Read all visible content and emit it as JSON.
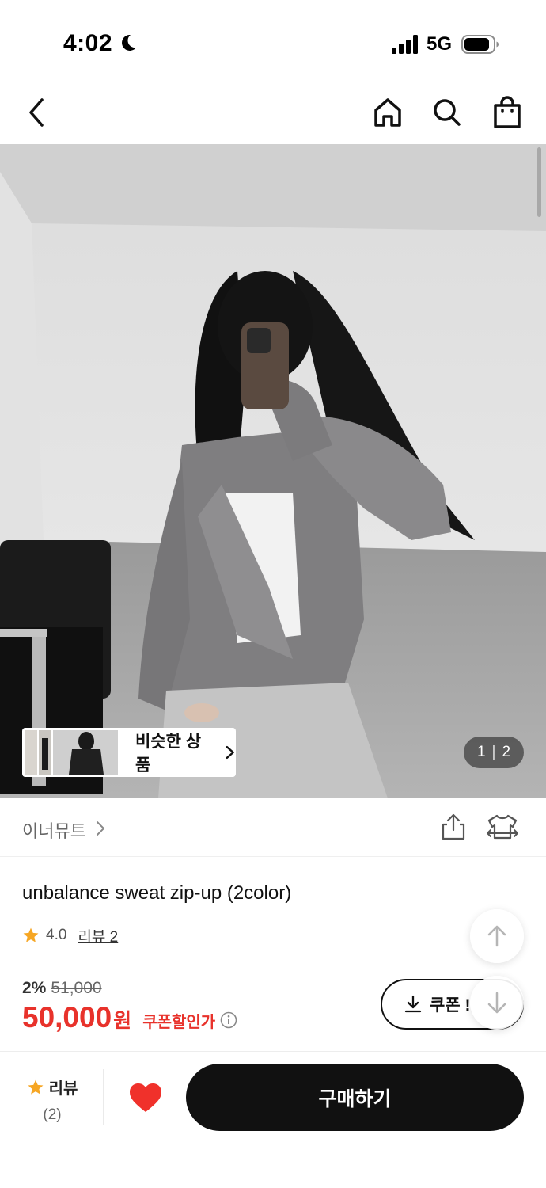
{
  "status_bar": {
    "time": "4:02",
    "network": "5G",
    "icons": [
      "moon-icon",
      "signal-icon",
      "battery-icon"
    ]
  },
  "top_nav": {
    "icons": [
      "back-arrow-icon",
      "home-icon",
      "search-icon",
      "shopping-bag-icon"
    ]
  },
  "gallery": {
    "similar_label": "비슷한 상품",
    "pager_current": "1",
    "pager_total": "2"
  },
  "brand": {
    "name": "이너뮤트",
    "icons": [
      "share-icon",
      "size-fit-icon"
    ]
  },
  "product": {
    "title": "unbalance sweat zip-up (2color)",
    "rating": "4.0",
    "review_link": "리뷰 2",
    "discount_rate": "2%",
    "original_price": "51,000",
    "price": "50,000",
    "price_unit": "원",
    "coupon_discount_label": "쿠폰할인가",
    "coupon_button": "쿠폰 !"
  },
  "bottom_bar": {
    "review_label": "리뷰",
    "review_count": "(2)",
    "buy_label": "구매하기"
  },
  "colors": {
    "accent_red": "#e8322b",
    "star": "#f6a623",
    "heart": "#f0312b",
    "buy_button": "#111111"
  }
}
